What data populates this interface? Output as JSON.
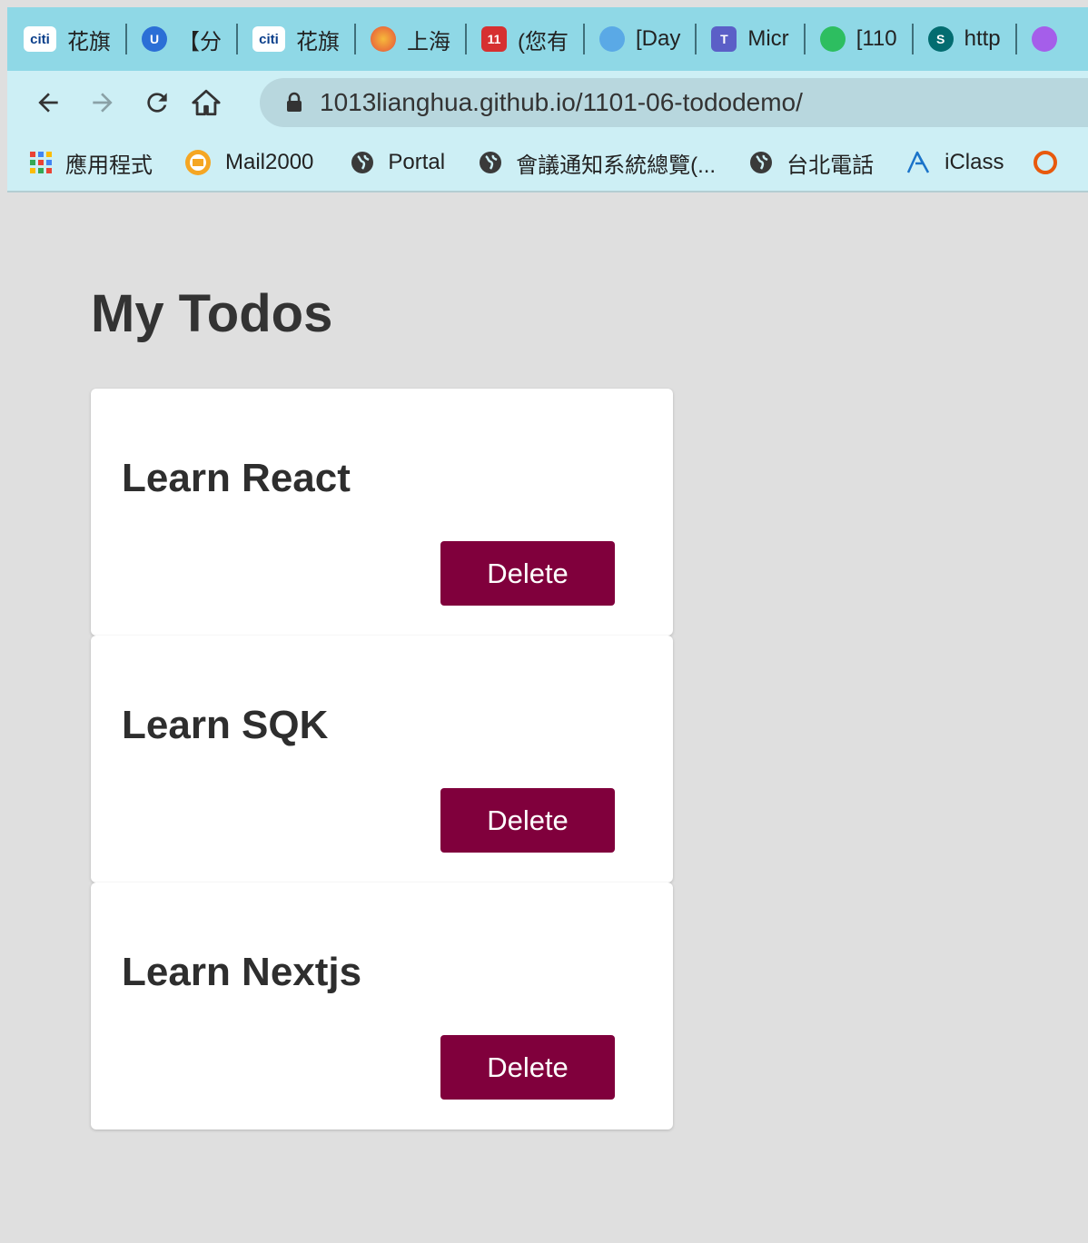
{
  "browser": {
    "tabs": [
      {
        "icon": "citi-icon",
        "label": "花旗"
      },
      {
        "icon": "u-icon",
        "label": "【分"
      },
      {
        "icon": "citi-icon",
        "label": "花旗"
      },
      {
        "icon": "brain-icon",
        "label": "上海"
      },
      {
        "icon": "calendar-icon",
        "label": "(您有"
      },
      {
        "icon": "globe-icon",
        "label": "[Day"
      },
      {
        "icon": "teams-icon",
        "label": "Micr"
      },
      {
        "icon": "evernote-icon",
        "label": "[110"
      },
      {
        "icon": "sharepoint-icon",
        "label": "http"
      }
    ],
    "url": "1013lianghua.github.io/1101-06-tododemo/",
    "bookmarks": [
      {
        "icon": "apps-grid-icon",
        "label": "應用程式"
      },
      {
        "icon": "mail-icon",
        "label": "Mail2000"
      },
      {
        "icon": "globe-icon",
        "label": "Portal"
      },
      {
        "icon": "globe-icon",
        "label": "會議通知系統總覽(..."
      },
      {
        "icon": "globe-icon",
        "label": "台北電話"
      },
      {
        "icon": "iclass-icon",
        "label": "iClass"
      }
    ]
  },
  "page": {
    "title": "My Todos",
    "todos": [
      {
        "title": "Learn React",
        "delete_label": "Delete"
      },
      {
        "title": "Learn SQK",
        "delete_label": "Delete"
      },
      {
        "title": "Learn Nextjs",
        "delete_label": "Delete"
      }
    ]
  },
  "colors": {
    "delete_button": "#80003c",
    "page_background": "#dfdfdf",
    "tabstrip": "#8fd8e6"
  }
}
